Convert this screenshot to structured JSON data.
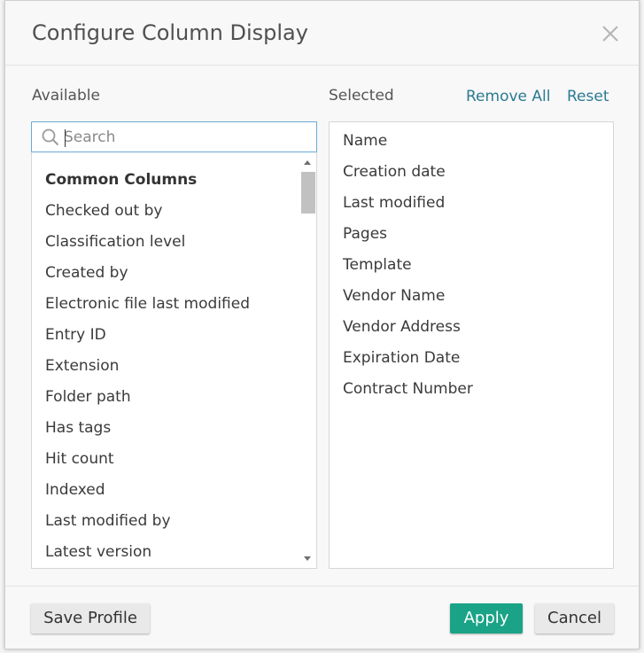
{
  "dialog": {
    "title": "Configure Column Display"
  },
  "available": {
    "label": "Available",
    "search_placeholder": "Search",
    "search_value": "",
    "group_header": "Common Columns",
    "items": [
      "Checked out by",
      "Classification level",
      "Created by",
      "Electronic file last modified",
      "Entry ID",
      "Extension",
      "Folder path",
      "Has tags",
      "Hit count",
      "Indexed",
      "Last modified by",
      "Latest version"
    ]
  },
  "selected": {
    "label": "Selected",
    "remove_all_label": "Remove All",
    "reset_label": "Reset",
    "items": [
      "Name",
      "Creation date",
      "Last modified",
      "Pages",
      "Template",
      "Vendor Name",
      "Vendor Address",
      "Expiration Date",
      "Contract Number"
    ]
  },
  "footer": {
    "save_profile_label": "Save Profile",
    "apply_label": "Apply",
    "cancel_label": "Cancel"
  },
  "colors": {
    "accent": "#1aa386",
    "link": "#2b7a94",
    "focus_border": "#6aa9d4"
  },
  "icons": {
    "close": "close-icon",
    "search": "search-icon",
    "scroll_up": "chevron-up-icon",
    "scroll_down": "chevron-down-icon"
  }
}
